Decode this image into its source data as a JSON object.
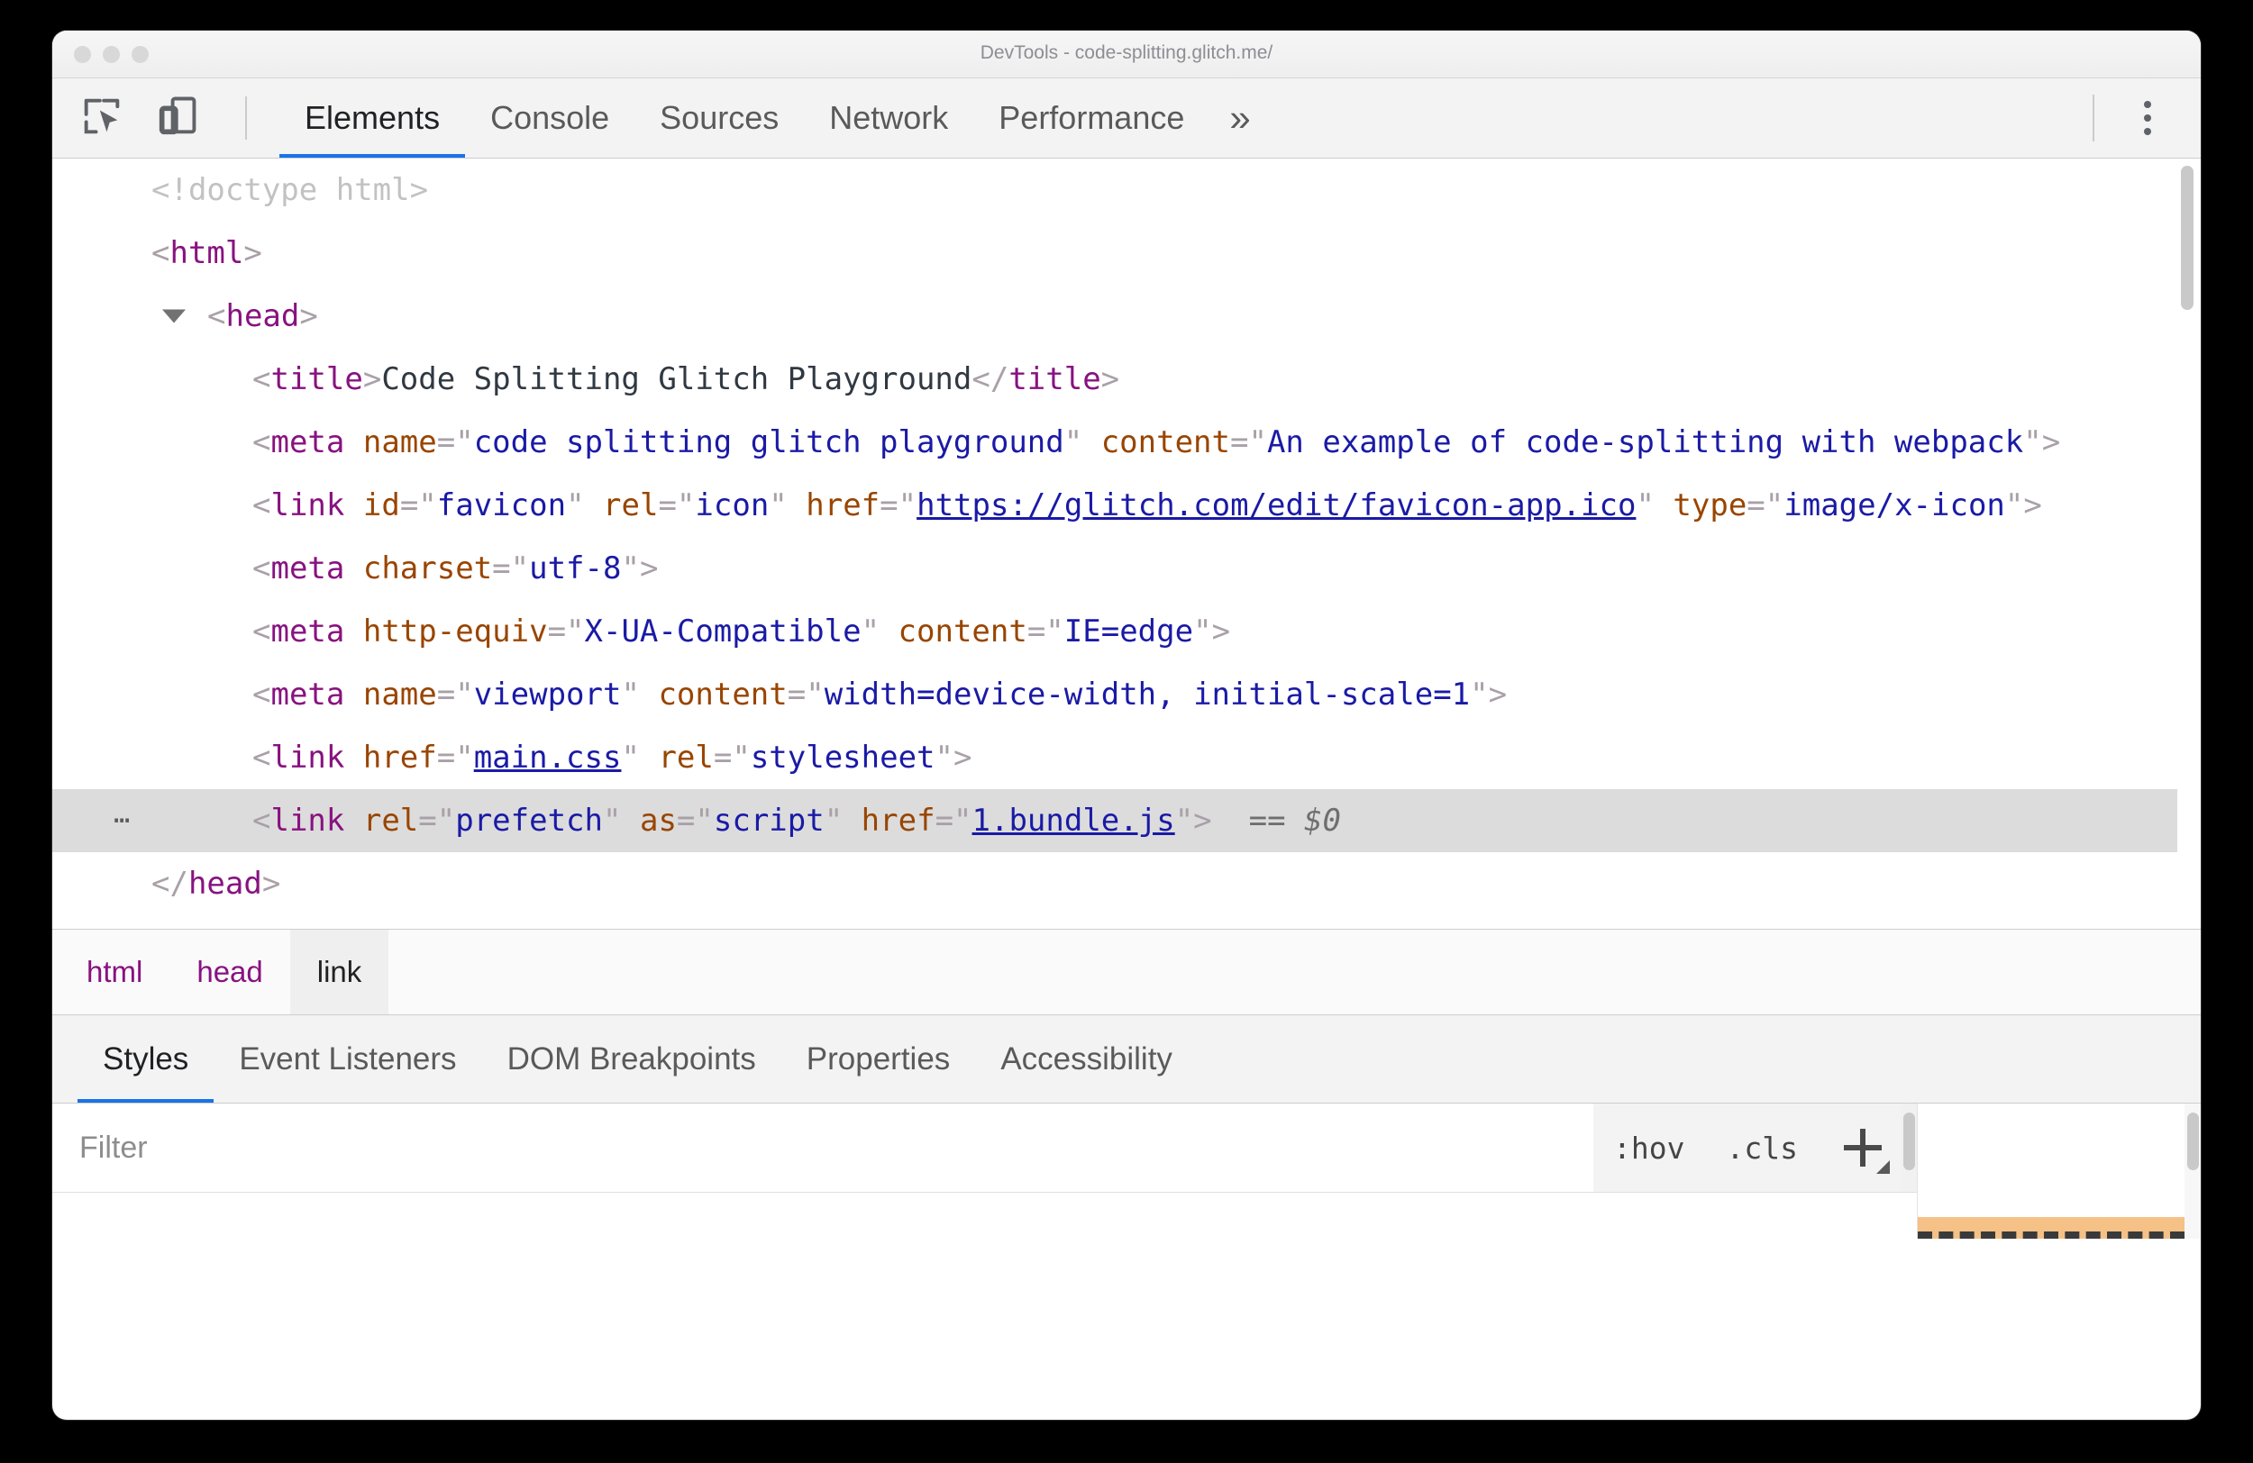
{
  "window": {
    "title": "DevTools - code-splitting.glitch.me/"
  },
  "toolbar": {
    "inspect_icon": "inspect-element-icon",
    "device_icon": "device-toolbar-icon",
    "more_tabs_label": "»",
    "menu_icon": "kebab-menu-icon",
    "tabs": [
      {
        "label": "Elements",
        "active": true
      },
      {
        "label": "Console",
        "active": false
      },
      {
        "label": "Sources",
        "active": false
      },
      {
        "label": "Network",
        "active": false
      },
      {
        "label": "Performance",
        "active": false
      }
    ]
  },
  "dom": {
    "doctype": "<!doctype html>",
    "html_open_lt": "<",
    "html_tag": "html",
    "html_gt": ">",
    "head_lt": "<",
    "head_tag": "head",
    "head_gt": ">",
    "title_line": {
      "lt": "<",
      "tag": "title",
      "gt": ">",
      "text": "Code Splitting Glitch Playground",
      "close_lt": "</",
      "close_tag": "title",
      "close_gt": ">"
    },
    "meta_description": {
      "lt": "<",
      "tag": "meta",
      "attr1": "name",
      "val1": "code splitting glitch playground",
      "attr2": "content",
      "val2": "An example of code-splitting with webpack",
      "gt": ">"
    },
    "link_favicon": {
      "lt": "<",
      "tag": "link",
      "attr1": "id",
      "val1": "favicon",
      "attr2": "rel",
      "val2": "icon",
      "attr3": "href",
      "val3": "https://glitch.com/edit/favicon-app.ico",
      "attr4": "type",
      "val4": "image/x-icon",
      "gt": ">"
    },
    "meta_charset": {
      "lt": "<",
      "tag": "meta",
      "attr1": "charset",
      "val1": "utf-8",
      "gt": ">"
    },
    "meta_compat": {
      "lt": "<",
      "tag": "meta",
      "attr1": "http-equiv",
      "val1": "X-UA-Compatible",
      "attr2": "content",
      "val2": "IE=edge",
      "gt": ">"
    },
    "meta_viewport": {
      "lt": "<",
      "tag": "meta",
      "attr1": "name",
      "val1": "viewport",
      "attr2": "content",
      "val2": "width=device-width, initial-scale=1",
      "gt": ">"
    },
    "link_maincss": {
      "lt": "<",
      "tag": "link",
      "attr1": "href",
      "val1": "main.css",
      "attr2": "rel",
      "val2": "stylesheet",
      "gt": ">"
    },
    "link_prefetch": {
      "badge": "⋯",
      "lt": "<",
      "tag": "link",
      "attr1": "rel",
      "val1": "prefetch",
      "attr2": "as",
      "val2": "script",
      "attr3": "href",
      "val3": "1.bundle.js",
      "gt": ">",
      "eqeq": "==",
      "selector": "$0"
    },
    "head_close_lt": "</",
    "head_close_tag": "head",
    "head_close_gt": ">"
  },
  "breadcrumb": {
    "items": [
      {
        "label": "html",
        "current": false
      },
      {
        "label": "head",
        "current": false
      },
      {
        "label": "link",
        "current": true
      }
    ]
  },
  "sidebar": {
    "tabs": [
      {
        "label": "Styles",
        "active": true
      },
      {
        "label": "Event Listeners",
        "active": false
      },
      {
        "label": "DOM Breakpoints",
        "active": false
      },
      {
        "label": "Properties",
        "active": false
      },
      {
        "label": "Accessibility",
        "active": false
      }
    ],
    "filter_placeholder": "Filter",
    "filter_value": "",
    "hov_label": ":hov",
    "cls_label": ".cls",
    "new_rule_icon": "plus-icon"
  },
  "colors": {
    "accent": "#1a73e8",
    "tag": "#881280",
    "attr": "#994500",
    "value": "#1a1aa6",
    "punct": "#a9a0a8",
    "selected_row": "#dcdcdc",
    "padding_box": "#f5c187"
  }
}
